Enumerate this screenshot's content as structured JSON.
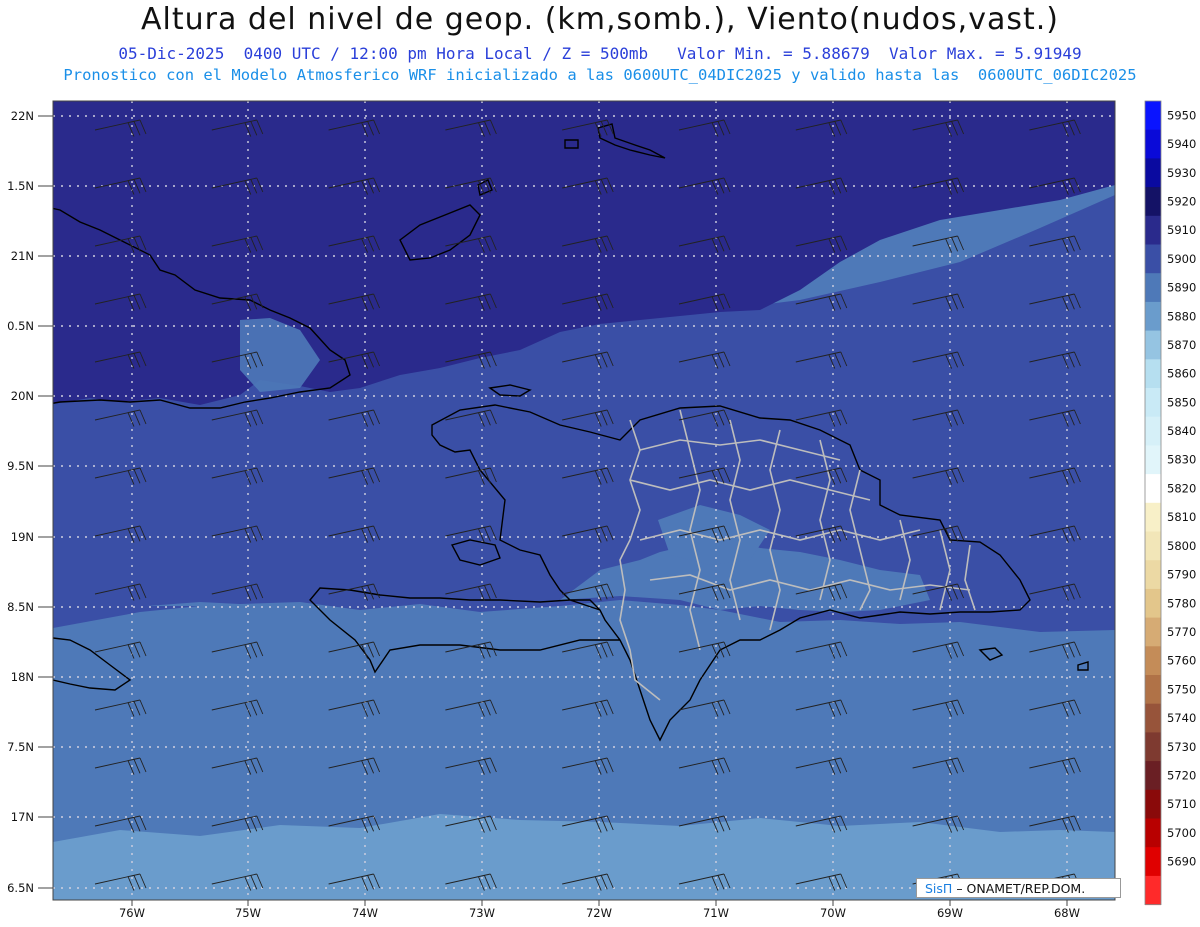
{
  "header": {
    "title": "Altura del nivel de geop. (km,somb.), Viento(nudos,vast.)",
    "subtitle1": "05-Dic-2025  0400 UTC / 12:00 pm Hora Local / Z = 500mb   Valor Min. = 5.88679  Valor Max. = 5.91949",
    "subtitle2": "Pronostico con el Modelo Atmosferico WRF inicializado a las 0600UTC_04DIC2025 y valido hasta las  0600UTC_06DIC2025"
  },
  "axes": {
    "lat_labels": [
      "22N",
      "1.5N",
      "21N",
      "0.5N",
      "20N",
      "9.5N",
      "19N",
      "8.5N",
      "18N",
      "7.5N",
      "17N",
      "6.5N"
    ],
    "lon_labels": [
      "76W",
      "75W",
      "74W",
      "73W",
      "72W",
      "71W",
      "70W",
      "69W",
      "68W"
    ]
  },
  "colorbar": {
    "labels": [
      "5950",
      "5940",
      "5930",
      "5920",
      "5910",
      "5900",
      "5890",
      "5880",
      "5870",
      "5860",
      "5850",
      "5840",
      "5830",
      "5820",
      "5810",
      "5800",
      "5790",
      "5780",
      "5770",
      "5760",
      "5750",
      "5740",
      "5730",
      "5720",
      "5710",
      "5700",
      "5690"
    ],
    "colors": [
      "#0a14ff",
      "#0a0ad8",
      "#0a0aa0",
      "#141266",
      "#2a2a8c",
      "#3a4fa6",
      "#4e79b8",
      "#6a9ccc",
      "#95c4e2",
      "#b6dff0",
      "#c9eaf6",
      "#d6f0f8",
      "#e1f5fa",
      "#ffffff",
      "#f8f0c8",
      "#f2e6b8",
      "#ecd9a4",
      "#e3c68b",
      "#d6ab74",
      "#c48c58",
      "#b07247",
      "#97543a",
      "#7e3a30",
      "#6a1f24",
      "#8a0a0a",
      "#b80000",
      "#e00000",
      "#ff2a2a"
    ]
  },
  "fill_colors": {
    "north_band": "#2a2a8c",
    "middle_band": "#3a4fa6",
    "south_band": "#4e79b8",
    "south_light": "#6a9ccc"
  },
  "credit": {
    "sis": "SisΠ",
    "org": "– ONAMET/REP.DOM."
  }
}
